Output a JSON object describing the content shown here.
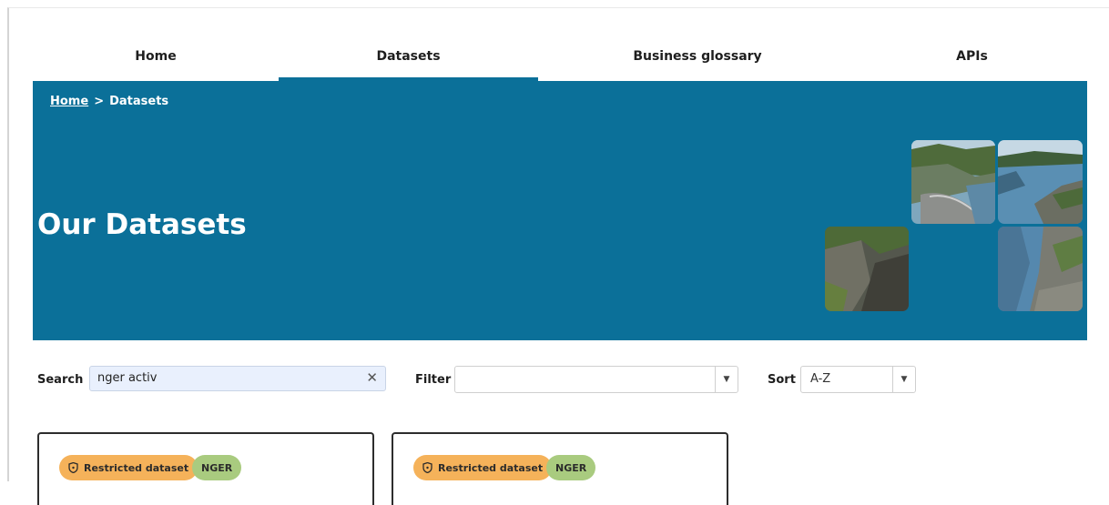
{
  "nav": {
    "items": [
      {
        "label": "Home",
        "active": false
      },
      {
        "label": "Datasets",
        "active": true
      },
      {
        "label": "Business glossary",
        "active": false
      },
      {
        "label": "APIs",
        "active": false
      }
    ],
    "accent": "#0b7099"
  },
  "hero": {
    "breadcrumb": {
      "home": "Home",
      "separator": ">",
      "current": "Datasets"
    },
    "title": "Our Datasets",
    "background": "#0b7099"
  },
  "controls": {
    "search": {
      "label": "Search",
      "value": "nger activ",
      "clear_icon": "close-icon"
    },
    "filter": {
      "label": "Filter",
      "value": ""
    },
    "sort": {
      "label": "Sort",
      "value": "A-Z"
    }
  },
  "cards": [
    {
      "restricted_label": "Restricted dataset",
      "tag": "NGER"
    },
    {
      "restricted_label": "Restricted dataset",
      "tag": "NGER"
    }
  ],
  "colors": {
    "restricted_badge": "#f5b25a",
    "tag_badge": "#a9cb7f"
  }
}
